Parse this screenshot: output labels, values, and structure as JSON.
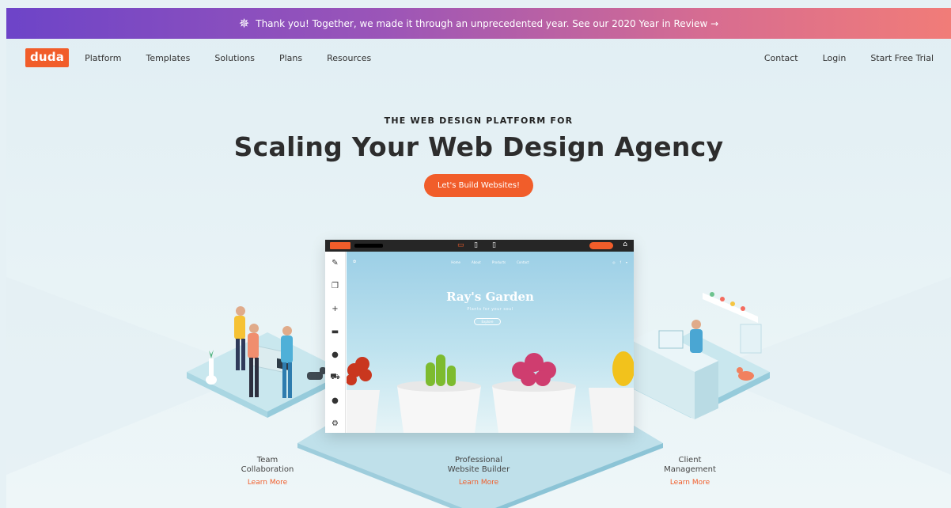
{
  "banner": {
    "text": "Thank you! Together, we made it through an unprecedented year. See our 2020 Year in Review",
    "arrow": "→",
    "icon": "fireworks-icon"
  },
  "nav": {
    "logo": "duda",
    "left_items": [
      "Platform",
      "Templates",
      "Solutions",
      "Plans",
      "Resources"
    ],
    "right_items": [
      "Contact",
      "Login",
      "Start Free Trial"
    ]
  },
  "hero": {
    "eyebrow": "THE WEB DESIGN PLATFORM FOR",
    "headline": "Scaling Your Web Design Agency",
    "cta_label": "Let's Build Websites!"
  },
  "editor": {
    "site_title": "Ray's Garden",
    "site_subtitle": "Plants for your soul",
    "site_links": [
      "Home",
      "About",
      "Products",
      "Contact"
    ],
    "site_button": "Explore",
    "tools": [
      "brush-icon",
      "layers-icon",
      "plus-icon",
      "folder-icon",
      "person-icon",
      "cart-icon",
      "chat-icon",
      "gear-icon"
    ]
  },
  "features": [
    {
      "title_line1": "Team",
      "title_line2": "Collaboration",
      "link": "Learn More"
    },
    {
      "title_line1": "Professional",
      "title_line2": "Website Builder",
      "link": "Learn More"
    },
    {
      "title_line1": "Client",
      "title_line2": "Management",
      "link": "Learn More"
    }
  ],
  "colors": {
    "accent": "#f15d2a",
    "banner_start": "#6d44c8",
    "banner_end": "#f17c78",
    "background": "#e6f1f5"
  }
}
